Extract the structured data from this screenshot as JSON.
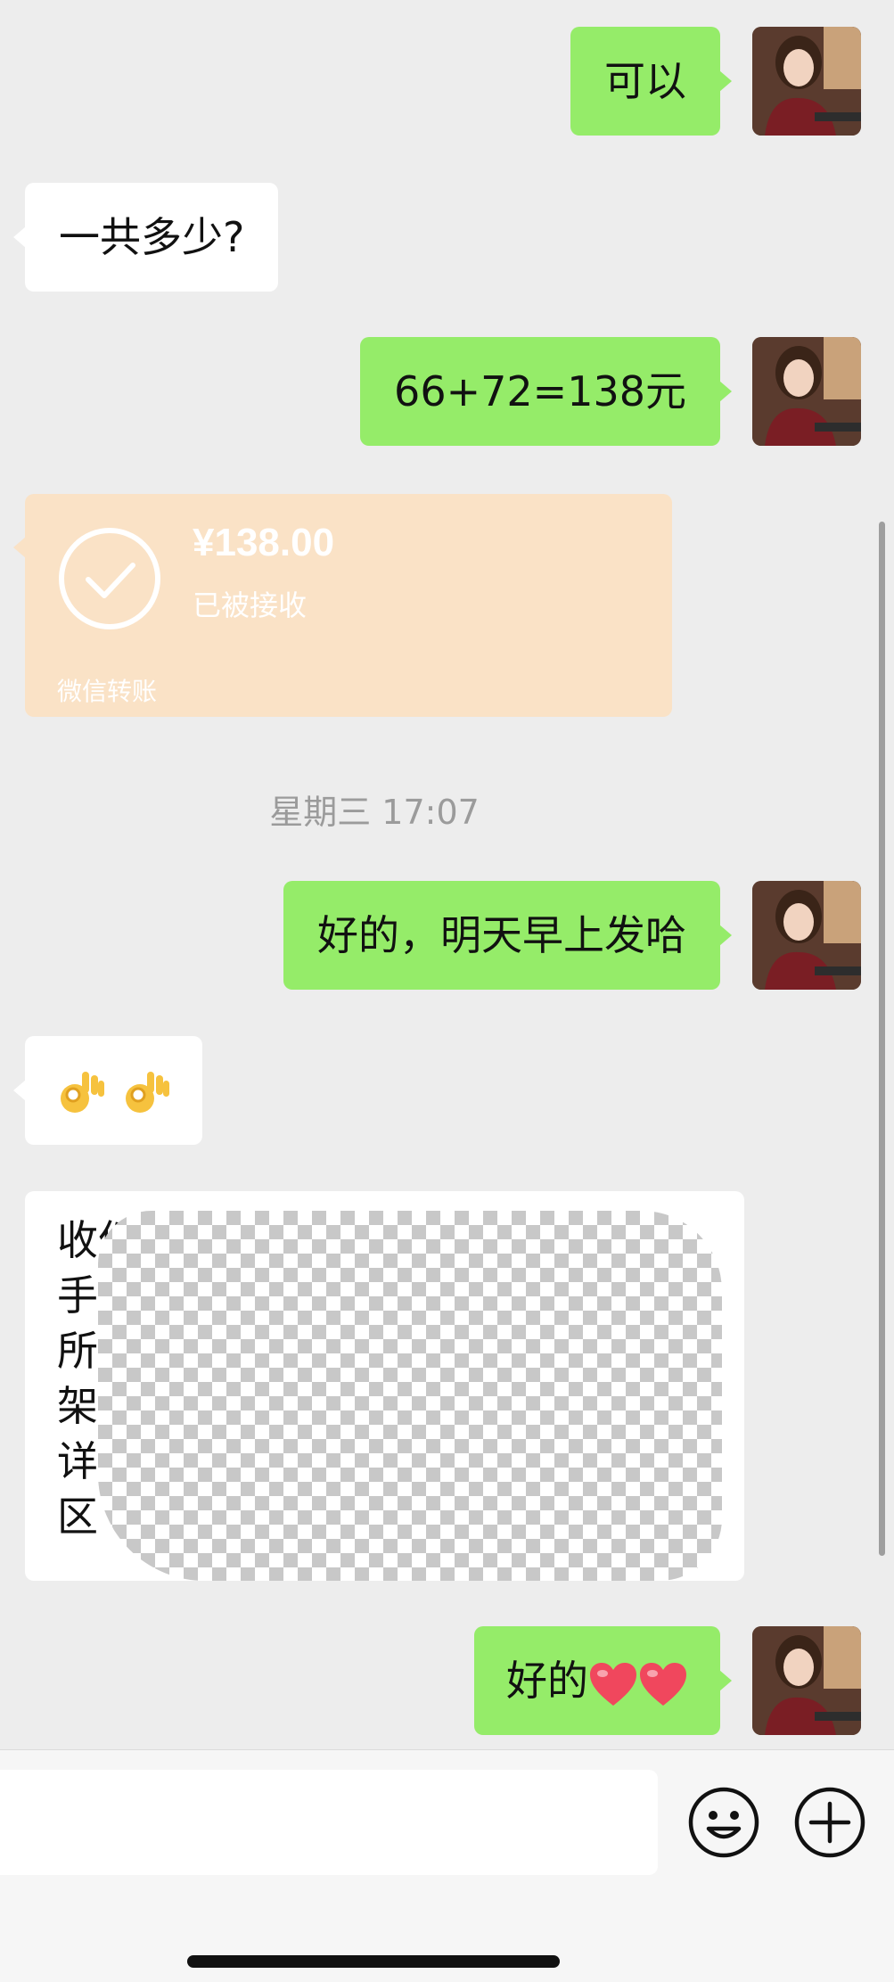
{
  "messages": [
    {
      "side": "out",
      "text": "可以"
    },
    {
      "side": "in",
      "text": "一共多少?"
    },
    {
      "side": "out",
      "text": "66+72=138元"
    },
    {
      "side": "out",
      "text": "好的，明天早上发哈"
    },
    {
      "side": "in",
      "text": "👌👌",
      "emoji_names": [
        "ok-hand-icon",
        "ok-hand-icon"
      ]
    },
    {
      "side": "out",
      "text": "好的",
      "emoji_names": [
        "red-heart-icon",
        "red-heart-icon"
      ]
    }
  ],
  "transfer": {
    "amount": "¥138.00",
    "status": "已被接收",
    "label": "微信转账",
    "icon": "check-circle-icon"
  },
  "timestamp": "星期三 17:07",
  "address_card": {
    "visible_line_starts": [
      "收件",
      "手",
      "所在",
      "架",
      "详",
      "区"
    ],
    "visible_tail": "小",
    "redacted": true
  },
  "input_bar": {
    "emoji_button_icon": "smiley-face-icon",
    "more_button_icon": "plus-circle-icon"
  },
  "colors": {
    "outgoing_bubble": "#95ec69",
    "incoming_bubble": "#ffffff",
    "transfer_card": "#fae2c6",
    "background": "#ededed"
  }
}
